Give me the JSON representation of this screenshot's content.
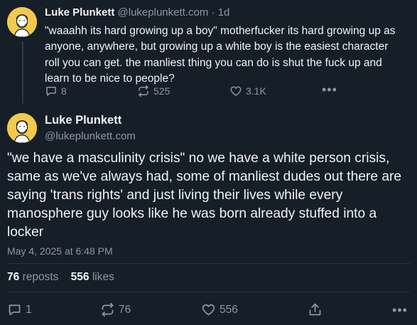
{
  "reply_post": {
    "author_name": "Luke Plunkett",
    "author_handle": "@lukeplunkett.com",
    "separator": "·",
    "time": "1d",
    "text": "\"waaahh its hard growing up a boy\" motherfucker its hard growing up as anyone, anywhere, but growing up a white boy is the easiest character roll you can get. the manliest thing you can do is shut the fuck up and learn to be nice to people?",
    "replies": "8",
    "reposts": "525",
    "likes": "3.1K"
  },
  "main_post": {
    "author_name": "Luke Plunkett",
    "author_handle": "@lukeplunkett.com",
    "text": "\"we have a masculinity crisis\" no we have a white person crisis, same as we've always had, some of manliest dudes out there are saying 'trans rights' and just living their lives while every manosphere guy looks like he was born already stuffed into a locker",
    "date": "May 4, 2025 at 6:48 PM",
    "repost_count": "76",
    "repost_label": "reposts",
    "like_count": "556",
    "like_label": "likes",
    "replies": "1",
    "reposts": "76",
    "likes": "556"
  },
  "icons": {
    "reply": "speech-bubble-icon",
    "repost": "repost-arrows-icon",
    "like": "heart-icon",
    "share": "share-icon",
    "more": "more-dots-icon"
  },
  "colors": {
    "background": "#161e27",
    "text": "#f1f3f5",
    "muted": "#8b98a5",
    "avatar": "#f2c94c"
  }
}
